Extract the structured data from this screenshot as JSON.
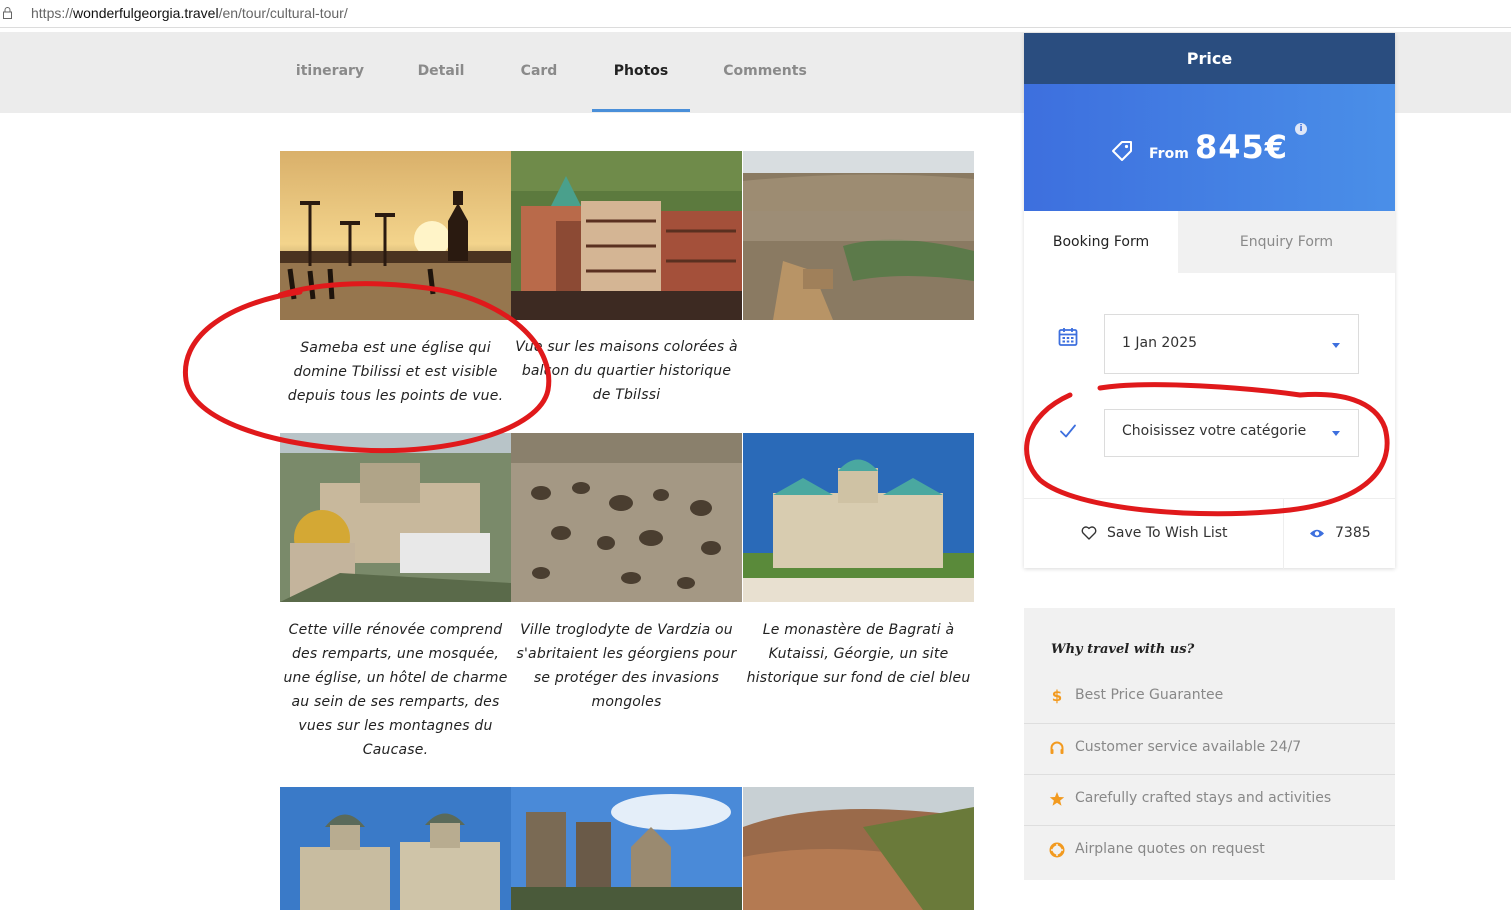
{
  "browser": {
    "url_scheme": "https://",
    "url_host": "wonderfulgeorgia.travel",
    "url_path": "/en/tour/cultural-tour/"
  },
  "tabs": [
    {
      "label": "itinerary"
    },
    {
      "label": "Detail"
    },
    {
      "label": "Card"
    },
    {
      "label": "Photos",
      "active": true
    },
    {
      "label": "Comments"
    }
  ],
  "gallery": {
    "captions": [
      "Sameba est une église qui domine Tbilissi et est visible depuis tous les points de vue.",
      "Vue sur les maisons colorées à balcon du quartier historique de Tbilssi",
      "",
      "Cette ville rénovée comprend des remparts, une mosquée, une église, un hôtel de charme au sein de ses remparts, des vues sur les montagnes du Caucase.",
      "Ville troglodyte de Vardzia ou s'abritaient les géorgiens pour se protéger des invasions mongoles",
      "Le monastère de Bagrati à Kutaissi, Géorgie, un site historique sur fond de ciel bleu"
    ]
  },
  "price": {
    "header": "Price",
    "from_label": "From",
    "amount": "845€",
    "info": "i"
  },
  "form_tabs": {
    "booking": "Booking Form",
    "enquiry": "Enquiry Form"
  },
  "booking": {
    "date_value": "1 Jan 2025",
    "category_value": "Choisissez votre catégorie"
  },
  "wishlist": {
    "label": "Save To Wish List",
    "views": "7385"
  },
  "why": {
    "title": "Why travel with us?",
    "items": [
      {
        "text": "Best Price Guarantee",
        "icon": "dollar-icon"
      },
      {
        "text": "Customer service available 24/7",
        "icon": "headset-icon"
      },
      {
        "text": "Carefully crafted stays and activities",
        "icon": "star-icon"
      },
      {
        "text": "Airplane quotes on request",
        "icon": "lifebuoy-icon"
      }
    ]
  },
  "colors": {
    "accent": "#3d6fde",
    "header_dark": "#2a4d7f",
    "annotation": "#e0191b",
    "why_icon": "#f29a1f"
  }
}
